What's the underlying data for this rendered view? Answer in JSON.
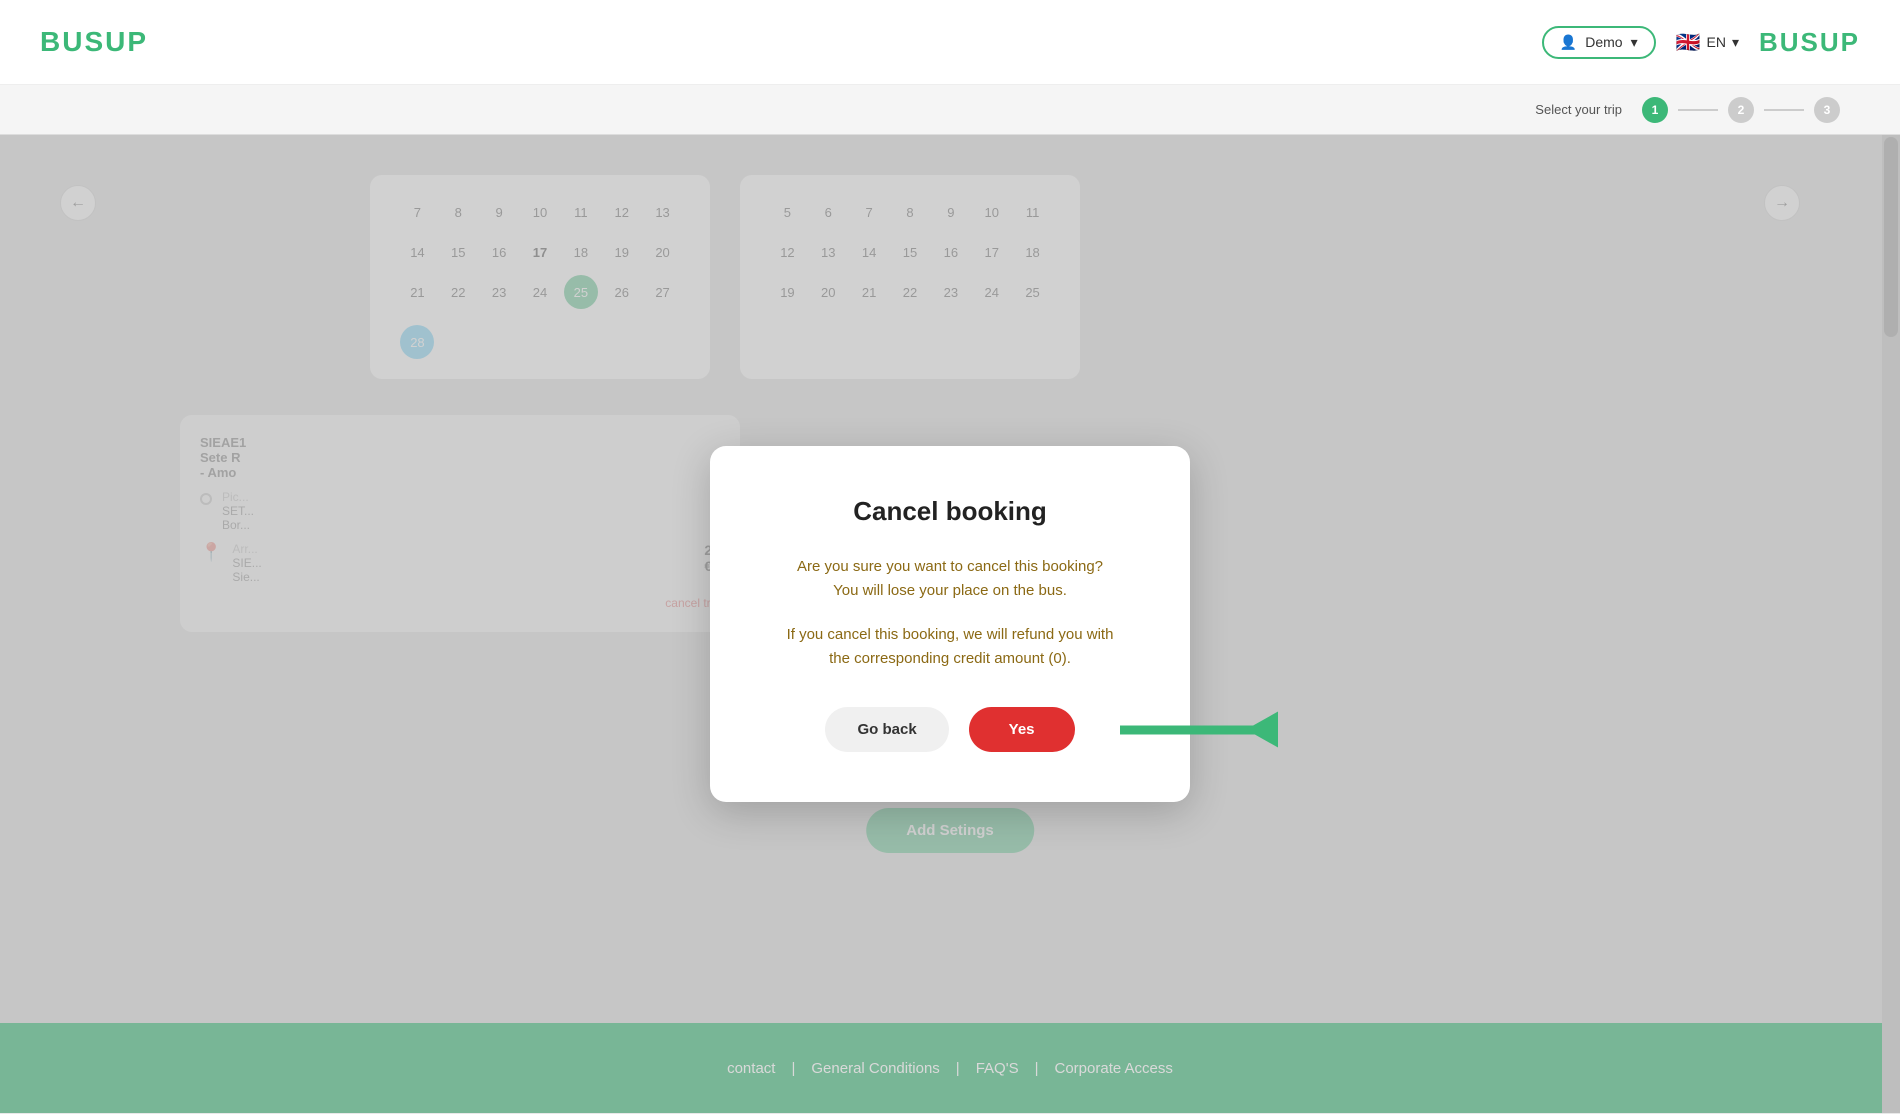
{
  "header": {
    "logo": "BUSUP",
    "logo_right": "BUSUP",
    "demo_label": "Demo",
    "lang": "EN"
  },
  "subheader": {
    "label": "Select your trip",
    "step1": "1",
    "step2": "2",
    "step3": "3"
  },
  "calendar1": {
    "days": [
      7,
      8,
      9,
      10,
      11,
      12,
      13,
      14,
      15,
      16,
      17,
      18,
      19,
      20,
      21,
      22,
      23,
      24,
      25,
      26,
      27,
      28
    ]
  },
  "calendar2": {
    "days": [
      5,
      6,
      7,
      8,
      9,
      10,
      11,
      12,
      13,
      14,
      15,
      16,
      17,
      18,
      19,
      20,
      21,
      22,
      23,
      24,
      25
    ]
  },
  "modal": {
    "title": "Cancel booking",
    "text1": "Are you sure you want to cancel this booking?",
    "text2": "You will lose your place on the bus.",
    "text3": "If you cancel this booking, we will refund you with",
    "text4": "the corresponding credit amount (0).",
    "go_back_label": "Go back",
    "yes_label": "Yes"
  },
  "add_settings": {
    "label": "Add Setings"
  },
  "footer": {
    "contact": "contact",
    "sep1": "|",
    "general_conditions": "General Conditions",
    "sep2": "|",
    "faqs": "FAQ'S",
    "sep3": "|",
    "corporate_access": "Corporate Access"
  },
  "colors": {
    "green": "#3cb878",
    "red": "#e03030",
    "arrow_green": "#3cb878"
  }
}
